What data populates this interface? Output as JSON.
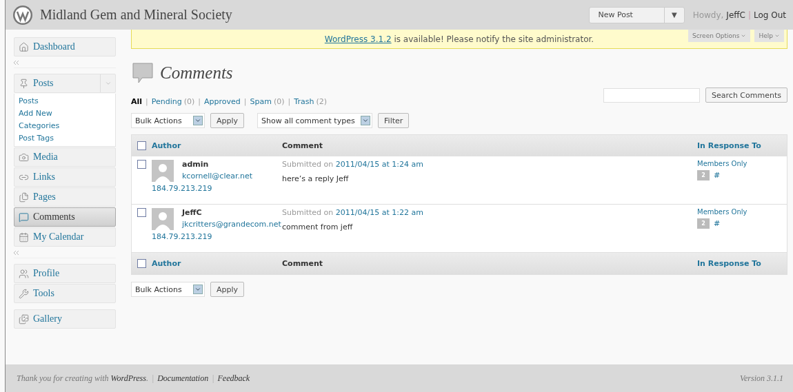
{
  "header": {
    "site_title": "Midland Gem and Mineral Society",
    "favorite_action": "New Post",
    "favorite_toggle": "▼",
    "greeting": "Howdy,",
    "user": "JeffC",
    "separator": "|",
    "logout": "Log Out"
  },
  "notice": {
    "link": "WordPress 3.1.2",
    "text": " is available! Please notify the site administrator.",
    "screen_options": "Screen Options",
    "help": "Help"
  },
  "sidebar": [
    {
      "kind": "menu",
      "label": "Dashboard",
      "selected": false
    },
    {
      "kind": "separator"
    },
    {
      "kind": "menu",
      "label": "Posts",
      "selected": false,
      "expanded": true,
      "children": [
        {
          "label": "Posts"
        },
        {
          "label": "Add New"
        },
        {
          "label": "Categories"
        },
        {
          "label": "Post Tags"
        }
      ]
    },
    {
      "kind": "menu",
      "label": "Media",
      "selected": false
    },
    {
      "kind": "menu",
      "label": "Links",
      "selected": false
    },
    {
      "kind": "menu",
      "label": "Pages",
      "selected": false
    },
    {
      "kind": "menu",
      "label": "Comments",
      "selected": true
    },
    {
      "kind": "menu",
      "label": "My Calendar",
      "selected": false
    },
    {
      "kind": "separator"
    },
    {
      "kind": "menu",
      "label": "Profile",
      "selected": false
    },
    {
      "kind": "menu",
      "label": "Tools",
      "selected": false
    },
    {
      "kind": "gap"
    },
    {
      "kind": "menu",
      "label": "Gallery",
      "selected": false
    }
  ],
  "page_title": "Comments",
  "filters": [
    {
      "label": "All",
      "selected": true
    },
    {
      "separator": "|",
      "label": "Pending",
      "count": "(0)",
      "selected": false
    },
    {
      "separator": "|",
      "label": "Approved",
      "selected": false
    },
    {
      "separator": "|",
      "label": "Spam",
      "count": "(0)",
      "selected": false
    },
    {
      "separator": "|",
      "label": "Trash",
      "count": "(2)",
      "selected": false
    }
  ],
  "search": {
    "button": "Search Comments"
  },
  "bulk_actions": {
    "value": "Bulk Actions",
    "apply": "Apply"
  },
  "type_filter": {
    "value": "Show all comment types",
    "button": "Filter"
  },
  "table": {
    "header": {
      "select_all_checked": false,
      "columns": [
        "Author",
        "Comment",
        "In Response To"
      ]
    },
    "rows": [
      {
        "checked": false,
        "author": "admin",
        "email": "kcornell@clear.net",
        "ip": "184.79.213.219",
        "submitted": "Submitted on",
        "date": "2011/04/15 at 1:24 am",
        "comment": "here’s a reply Jeff",
        "post": "Members Only",
        "count": "2",
        "hash": "#"
      },
      {
        "checked": false,
        "author": "JeffC",
        "email": "jkcritters@grandecom.net",
        "ip": "184.79.213.219",
        "submitted": "Submitted on",
        "date": "2011/04/15 at 1:22 am",
        "comment": "comment from jeff",
        "post": "Members Only",
        "count": "2",
        "hash": "#"
      }
    ],
    "footer": {
      "select_all_checked": false,
      "columns": [
        "Author",
        "Comment",
        "In Response To"
      ]
    }
  },
  "bulk_actions_bottom": {
    "value": "Bulk Actions",
    "apply": "Apply"
  },
  "footer": {
    "prefix": "Thank you for creating with ",
    "link": "WordPress",
    "suffix": ".",
    "links": [
      {
        "separator": "|",
        "label": "Documentation"
      },
      {
        "separator": "|",
        "label": "Feedback"
      }
    ],
    "version": "Version 3.1.1"
  }
}
